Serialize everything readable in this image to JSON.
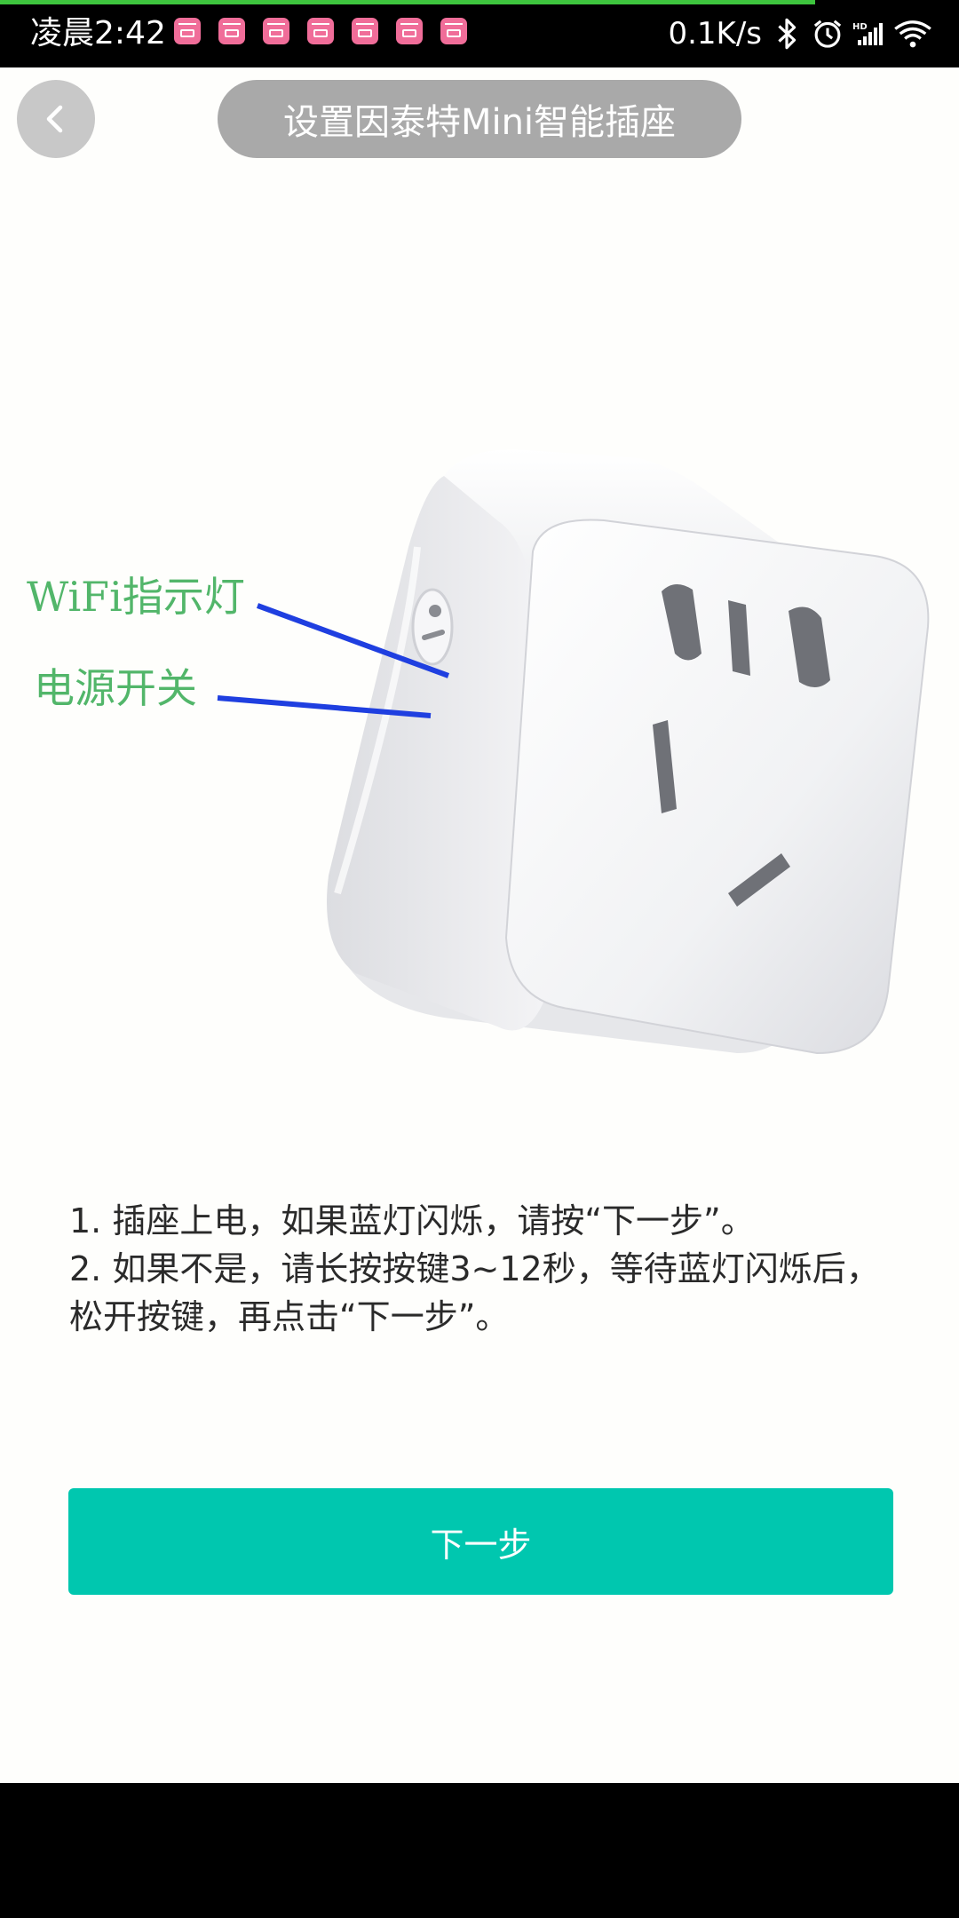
{
  "status_bar": {
    "time": "凌晨2:42",
    "net_speed": "0.1K/s",
    "notification_icons": [
      "app-notification-icon",
      "app-notification-icon",
      "app-notification-icon",
      "app-notification-icon",
      "app-notification-icon",
      "app-notification-icon",
      "app-notification-icon"
    ],
    "right_icons": [
      "bluetooth-icon",
      "alarm-icon",
      "hd-signal-icon",
      "wifi-icon"
    ],
    "top_progress": 0.85
  },
  "header": {
    "title": "设置因泰特Mini智能插座",
    "back_icon": "chevron-left-icon"
  },
  "illustration": {
    "label_wifi": "WiFi指示灯",
    "label_power": "电源开关",
    "label_color": "#52b66a",
    "pointer_color": "#1f3fe0"
  },
  "instructions": {
    "line1": "1. 插座上电，如果蓝灯闪烁，请按“下一步”。",
    "line2": "2. 如果不是，请长按按键3~12秒，等待蓝灯闪烁后，松开按键，再点击“下一步”。"
  },
  "actions": {
    "next_label": "下一步",
    "accent": "#00c7af"
  }
}
